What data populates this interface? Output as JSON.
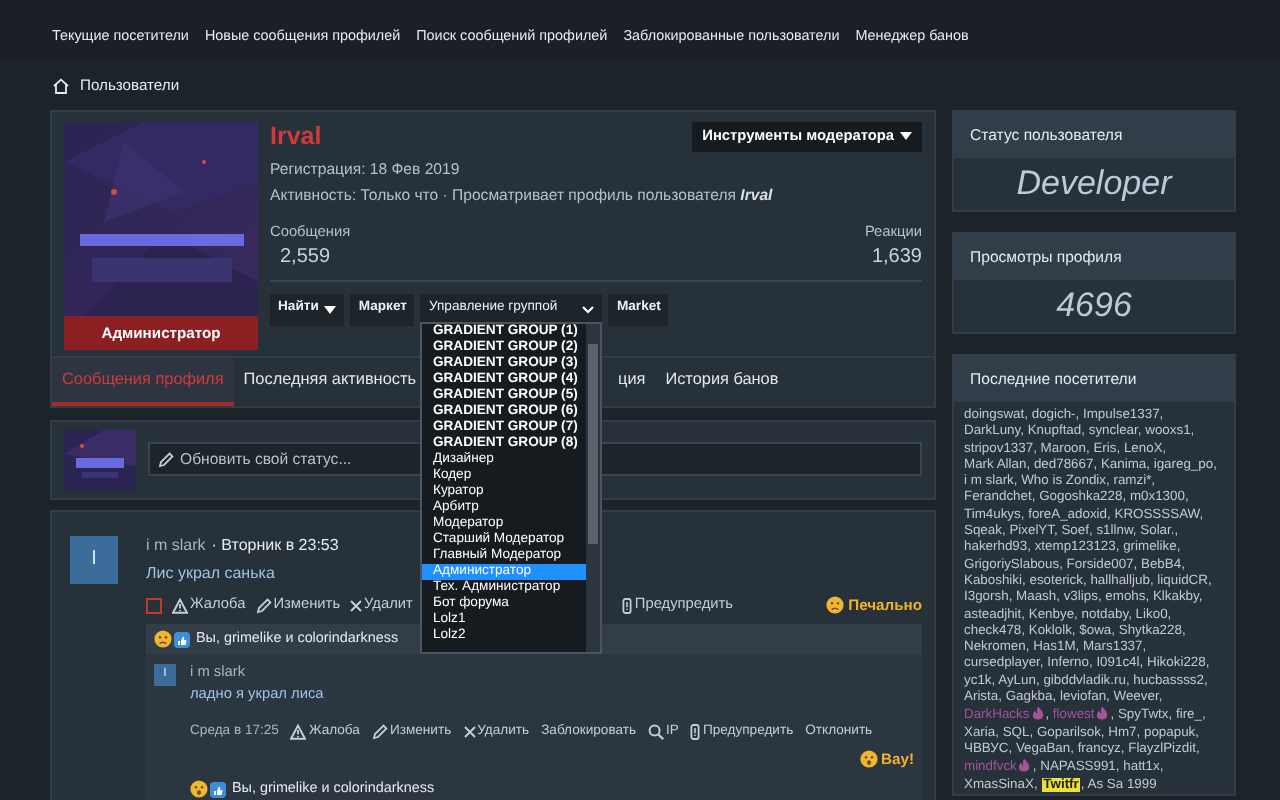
{
  "nav": [
    "Текущие посетители",
    "Новые сообщения профилей",
    "Поиск сообщений профилей",
    "Заблокированные пользователи",
    "Менеджер банов"
  ],
  "breadcrumb": "Пользователи",
  "profile": {
    "name": "Irval",
    "role": "Администратор",
    "registration": "Регистрация: 18 Фев 2019",
    "activity": "Активность: Только что · Просматривает профиль пользователя **Irval**",
    "mod_tools": "Инструменты модератора",
    "stats": [
      {
        "label": "Сообщения",
        "value": "2,559"
      },
      {
        "label": "Реакции",
        "value": "1,639"
      }
    ],
    "actions": [
      {
        "label": "Найти",
        "kind": "dropdown"
      },
      {
        "label": "Маркет",
        "kind": "button"
      },
      {
        "label": "Управление группой",
        "kind": "select"
      },
      {
        "label": "Market",
        "kind": "button"
      }
    ],
    "group_options": [
      {
        "label": "GRADIENT GROUP (1)",
        "selected": false
      },
      {
        "label": "GRADIENT GROUP (2)",
        "selected": false
      },
      {
        "label": "GRADIENT GROUP (3)",
        "selected": false
      },
      {
        "label": "GRADIENT GROUP (4)",
        "selected": false
      },
      {
        "label": "GRADIENT GROUP (5)",
        "selected": false
      },
      {
        "label": "GRADIENT GROUP (6)",
        "selected": false
      },
      {
        "label": "GRADIENT GROUP (7)",
        "selected": false
      },
      {
        "label": "GRADIENT GROUP (8)",
        "selected": false
      },
      {
        "label": "Дизайнер",
        "selected": false
      },
      {
        "label": "Кодер",
        "selected": false
      },
      {
        "label": "Куратор",
        "selected": false
      },
      {
        "label": "Арбитр",
        "selected": false
      },
      {
        "label": "Модератор",
        "selected": false
      },
      {
        "label": "Старший Модератор",
        "selected": false
      },
      {
        "label": "Главный Модератор",
        "selected": false
      },
      {
        "label": "Администратор",
        "selected": true
      },
      {
        "label": "Тех. Администратор",
        "selected": false
      },
      {
        "label": "Бот форума",
        "selected": false
      },
      {
        "label": "Lolz1",
        "selected": false
      },
      {
        "label": "Lolz2",
        "selected": false
      }
    ],
    "tabs": [
      {
        "label": "Сообщения профиля",
        "selected": true
      },
      {
        "label": "Последняя активность",
        "selected": false
      },
      {
        "label": "ция",
        "selected": false
      },
      {
        "label": "История банов",
        "selected": false
      }
    ]
  },
  "status_field": {
    "placeholder": "Обновить свой статус..."
  },
  "post": {
    "avatar_letter": "I",
    "author": "i m slark",
    "time": "· Вторник в 23:53",
    "text": "Лис украл санька",
    "checked": false,
    "actions": [
      {
        "label": "Жалоба",
        "kind": "warning"
      },
      {
        "label": "Изменить",
        "kind": "pencil"
      },
      {
        "label": "Удалит",
        "kind": "cross"
      },
      {
        "label": "Предупредить",
        "kind": "alert"
      }
    ],
    "reaction": "Печально",
    "reacted_by": "Вы, grimelike и colorindarkness",
    "comment": {
      "avatar_letter": "I",
      "author": "i m slark",
      "text": "ладно я украл лиса",
      "time": "Среда в 17:25",
      "actions": [
        {
          "label": "Жалоба",
          "kind": "warning"
        },
        {
          "label": "Изменить",
          "kind": "pencil"
        },
        {
          "label": "Удалить",
          "kind": "cross"
        },
        {
          "label": "Заблокировать",
          "kind": "plain"
        },
        {
          "label": "IP",
          "kind": "search"
        },
        {
          "label": "Предупредить",
          "kind": "alert"
        },
        {
          "label": "Отклонить",
          "kind": "plain"
        }
      ],
      "reaction": "Вау!",
      "reacted_by": "Вы, grimelike и colorindarkness"
    }
  },
  "sidebar": {
    "status": {
      "title": "Статус пользователя",
      "value": "Developer"
    },
    "views": {
      "title": "Просмотры профиля",
      "value": "4696"
    },
    "visitors": {
      "title": "Последние посетители",
      "separator": ",",
      "names": [
        {
          "name": "doingswat"
        },
        {
          "name": "dogich-"
        },
        {
          "name": "Impulse1337"
        },
        {
          "name": "DarkLuny"
        },
        {
          "name": "Knupftad"
        },
        {
          "name": "synclear"
        },
        {
          "name": "wooxs1"
        },
        {
          "name": "stripov1337"
        },
        {
          "name": "Maroon"
        },
        {
          "name": "Eris"
        },
        {
          "name": "LenoX"
        },
        {
          "name": "Mark Allan"
        },
        {
          "name": "ded78667"
        },
        {
          "name": "Kanima"
        },
        {
          "name": "igareg_po"
        },
        {
          "name": "i m slark"
        },
        {
          "name": "Who is Zondix"
        },
        {
          "name": "ramzi*"
        },
        {
          "name": "Ferandchet"
        },
        {
          "name": "Gogoshka228"
        },
        {
          "name": "m0x1300"
        },
        {
          "name": "Tim4ukys"
        },
        {
          "name": "foreA_adoxid"
        },
        {
          "name": "KROSSSSAW"
        },
        {
          "name": "Sqeak"
        },
        {
          "name": "PixelYT"
        },
        {
          "name": "Soef"
        },
        {
          "name": "s1llnw"
        },
        {
          "name": "Solar."
        },
        {
          "name": "hakerhd93"
        },
        {
          "name": "xtemp123123"
        },
        {
          "name": "grimelike"
        },
        {
          "name": "GrigoriySlabous"
        },
        {
          "name": "Forside007"
        },
        {
          "name": "BebB4"
        },
        {
          "name": "Kaboshiki"
        },
        {
          "name": "esoterick"
        },
        {
          "name": "hallhalljub"
        },
        {
          "name": "liquidCR"
        },
        {
          "name": "I3gorsh"
        },
        {
          "name": "Maash"
        },
        {
          "name": "v3lips"
        },
        {
          "name": "emohs"
        },
        {
          "name": "Klkakby"
        },
        {
          "name": "asteadjhit"
        },
        {
          "name": "Kenbye"
        },
        {
          "name": "notdaby"
        },
        {
          "name": "Liko0"
        },
        {
          "name": "check478"
        },
        {
          "name": "Koklolk"
        },
        {
          "name": "$owa"
        },
        {
          "name": "Shytka228"
        },
        {
          "name": "Nekromen"
        },
        {
          "name": "Has1M"
        },
        {
          "name": "Mars1337"
        },
        {
          "name": "cursedplayer"
        },
        {
          "name": "Inferno"
        },
        {
          "name": "I091c4l"
        },
        {
          "name": "Hikoki228"
        },
        {
          "name": "yc1k"
        },
        {
          "name": "AyLun"
        },
        {
          "name": "gibddvladik.ru"
        },
        {
          "name": "hucbassss2"
        },
        {
          "name": "Arista"
        },
        {
          "name": "Gagkba"
        },
        {
          "name": "leviofan"
        },
        {
          "name": "Weever"
        },
        {
          "name": "DarkHacks",
          "kind": "special",
          "color": "#a4529a"
        },
        {
          "name": "flowest",
          "kind": "special",
          "color": "#a4529a"
        },
        {
          "name": "SpyTwtx"
        },
        {
          "name": "fire_"
        },
        {
          "name": "Xaria"
        },
        {
          "name": "SQL"
        },
        {
          "name": "Goparilsok"
        },
        {
          "name": "Hm7"
        },
        {
          "name": "popapuk"
        },
        {
          "name": "ЧВВУС"
        },
        {
          "name": "VegaBan"
        },
        {
          "name": "francyz"
        },
        {
          "name": "FlayzlPizdit"
        },
        {
          "name": "mindfvck",
          "kind": "special",
          "color": "#a4529a"
        },
        {
          "name": "NAPASS991"
        },
        {
          "name": "hatt1x"
        },
        {
          "name": "XmasSinaX"
        },
        {
          "name": "Twitfr",
          "kind": "highlight"
        },
        {
          "name": "As Sa 1999"
        }
      ]
    }
  }
}
